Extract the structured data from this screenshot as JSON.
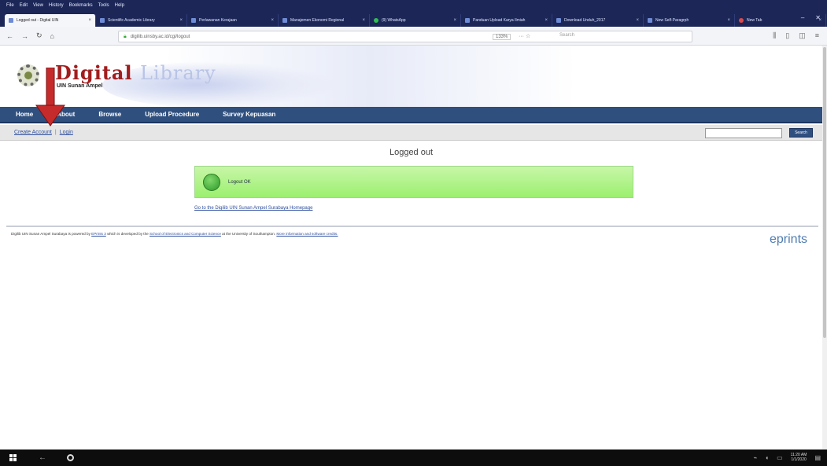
{
  "browser": {
    "menu": [
      "File",
      "Edit",
      "View",
      "History",
      "Bookmarks",
      "Tools",
      "Help"
    ],
    "tabs": [
      {
        "label": "Logged out - Digital UIN",
        "active": true,
        "icon": "page"
      },
      {
        "label": "Scientific Academic Library",
        "active": false,
        "icon": "page"
      },
      {
        "label": "Perlawanan Kerajaan",
        "active": false,
        "icon": "page"
      },
      {
        "label": "Manajemen Ekonomi Regional",
        "active": false,
        "icon": "page"
      },
      {
        "label": "(9) WhatsApp",
        "active": false,
        "icon": "whatsapp"
      },
      {
        "label": "Panduan Upload Karya Ilmiah",
        "active": false,
        "icon": "page"
      },
      {
        "label": "Download Unduh_2017",
        "active": false,
        "icon": "page"
      },
      {
        "label": "New Self-Paragrph",
        "active": false,
        "icon": "page"
      },
      {
        "label": "New Tab",
        "active": false,
        "icon": "firefox"
      }
    ],
    "url": "digilib.uinsby.ac.id/cgi/logout",
    "zoom": "133%",
    "search_placeholder": "Search"
  },
  "site": {
    "logo_title_colored": "Digital",
    "logo_title_light": "Library",
    "logo_subtitle": "UIN Sunan Ampel",
    "menu": [
      "Home",
      "About",
      "Browse",
      "Upload Procedure",
      "Survey Kepuasan"
    ],
    "sublinks": {
      "create_account": "Create Account",
      "separator": "|",
      "login": "Login"
    },
    "search_button": "Search"
  },
  "main": {
    "title": "Logged out",
    "message": "Logout OK",
    "home_link": "Go to the Digilib UIN Sunan Ampel Surabaya Homepage"
  },
  "footer": {
    "text_before": "Digilib UIN Sunan Ampel Surabaya is powered by",
    "eprints_link": "EPrints 3",
    "text_middle": "which is developed by the",
    "school_link": "School of Electronics and Computer Science",
    "text_after": "at the University of Southampton.",
    "more_link": "More information and software credits.",
    "brand": "eprints"
  },
  "taskbar": {
    "time": "11:20 AM",
    "date": "1/1/2020"
  }
}
